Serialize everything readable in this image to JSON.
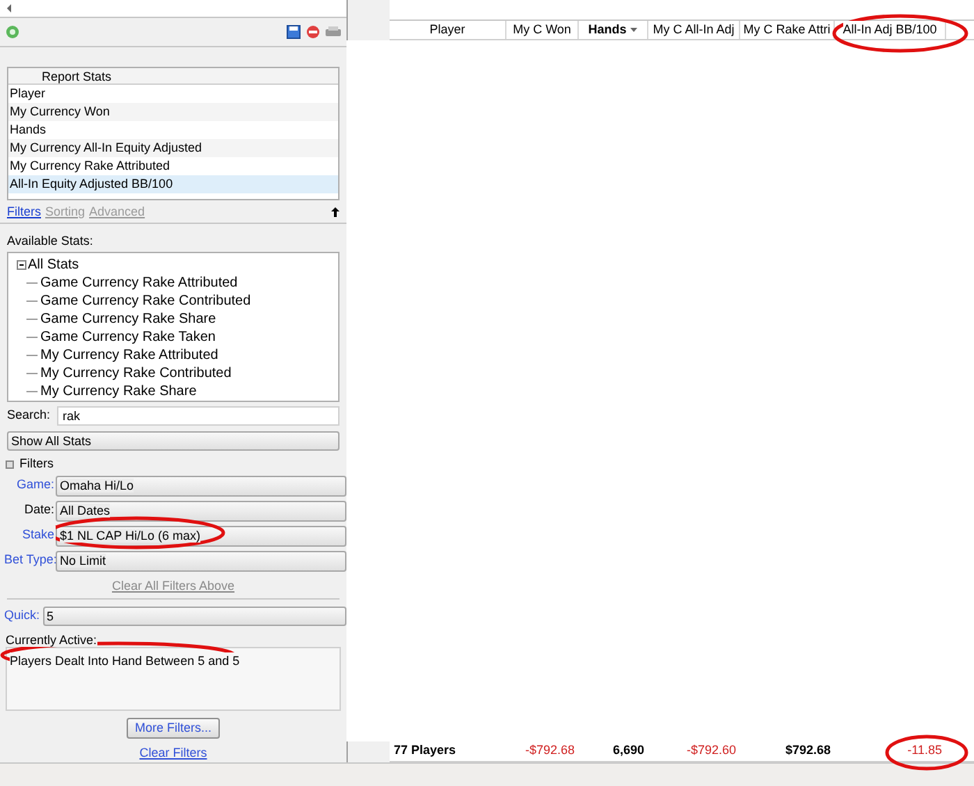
{
  "report_stats": {
    "header": "Report Stats",
    "rows": [
      {
        "label": "Player",
        "selected": false
      },
      {
        "label": "My Currency Won",
        "selected": false
      },
      {
        "label": "Hands",
        "selected": false
      },
      {
        "label": "My Currency All-In Equity Adjusted",
        "selected": false
      },
      {
        "label": "My Currency Rake Attributed",
        "selected": false
      },
      {
        "label": "All-In Equity Adjusted BB/100",
        "selected": true
      }
    ]
  },
  "panel_tabs": [
    {
      "label": "Filters",
      "selected": true
    },
    {
      "label": "Sorting",
      "selected": false
    },
    {
      "label": "Advanced",
      "selected": false
    }
  ],
  "available_stats": {
    "label": "Available Stats:",
    "tree": {
      "label": "All Stats",
      "expanded": true,
      "children": [
        {
          "label": "Game Currency Rake Attributed"
        },
        {
          "label": "Game Currency Rake Contributed"
        },
        {
          "label": "Game Currency Rake Share"
        },
        {
          "label": "Game Currency Rake Taken"
        },
        {
          "label": "My Currency Rake Attributed"
        },
        {
          "label": "My Currency Rake Contributed"
        },
        {
          "label": "My Currency Rake Share"
        }
      ]
    }
  },
  "search": {
    "label": "Search:",
    "value": "rak"
  },
  "stats_dropdown": {
    "value": "Show All Stats"
  },
  "filters": {
    "title": "Filters",
    "expanded": true,
    "fields": [
      {
        "label": "Game:",
        "link": true,
        "value": "Omaha Hi/Lo"
      },
      {
        "label": "Date:",
        "link": false,
        "value": "All Dates"
      },
      {
        "label": "Stake",
        "link": true,
        "value": "$1 NL CAP Hi/Lo (6 max)"
      },
      {
        "label": "Bet Type:",
        "link": true,
        "value": "No Limit"
      }
    ],
    "clear_above": "Clear All Filters Above",
    "quick": {
      "label": "Quick:",
      "value": "5"
    },
    "active_label": "Currently Active:",
    "active": [
      "Players Dealt Into Hand Between 5 and 5"
    ],
    "more_button": "More Filters...",
    "clear_link": "Clear Filters"
  },
  "grid": {
    "columns": [
      {
        "label": "Player",
        "sorted": false
      },
      {
        "label": "My C Won",
        "sorted": false
      },
      {
        "label": "Hands",
        "sorted": true
      },
      {
        "label": "My C All-In Adj",
        "sorted": false
      },
      {
        "label": "My C Rake Attri",
        "sorted": false
      },
      {
        "label": "All-In Adj BB/100",
        "sorted": false
      }
    ],
    "totals": [
      {
        "text": "77 Players",
        "negative": false
      },
      {
        "text": "-$792.68",
        "negative": true
      },
      {
        "text": "6,690",
        "negative": false
      },
      {
        "text": "-$792.60",
        "negative": true
      },
      {
        "text": "$792.68",
        "negative": false
      },
      {
        "text": "-11.85",
        "negative": true
      }
    ]
  }
}
